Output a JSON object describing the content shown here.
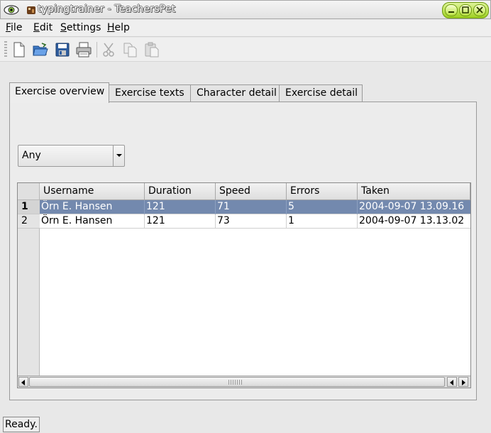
{
  "window": {
    "title": "typingtrainer - TeachersPet"
  },
  "menu": {
    "items": [
      {
        "label": "File",
        "mnemonic": "F"
      },
      {
        "label": "Edit",
        "mnemonic": "E"
      },
      {
        "label": "Settings",
        "mnemonic": "S"
      },
      {
        "label": "Help",
        "mnemonic": "H"
      }
    ]
  },
  "toolbar": {
    "icons": [
      "new-document-icon",
      "open-folder-icon",
      "save-icon",
      "print-icon",
      "cut-icon",
      "copy-icon",
      "paste-icon"
    ]
  },
  "tabs": [
    {
      "label": "Exercise overview",
      "active": true
    },
    {
      "label": "Exercise texts",
      "active": false
    },
    {
      "label": "Character detail",
      "active": false
    },
    {
      "label": "Exercise detail",
      "active": false
    }
  ],
  "filter": {
    "value": "Any"
  },
  "table": {
    "columns": [
      "Username",
      "Duration",
      "Speed",
      "Errors",
      "Taken"
    ],
    "rows": [
      {
        "num": "1",
        "cells": [
          "Örn E. Hansen",
          "121",
          "71",
          "5",
          "2004-09-07 13.09.16"
        ],
        "selected": true
      },
      {
        "num": "2",
        "cells": [
          "Örn E. Hansen",
          "121",
          "73",
          "1",
          "2004-09-07 13.13.02"
        ],
        "selected": false
      }
    ]
  },
  "status": {
    "text": "Ready."
  },
  "colors": {
    "selection": "#7389ae",
    "wm_buttons": "#b8e040"
  }
}
